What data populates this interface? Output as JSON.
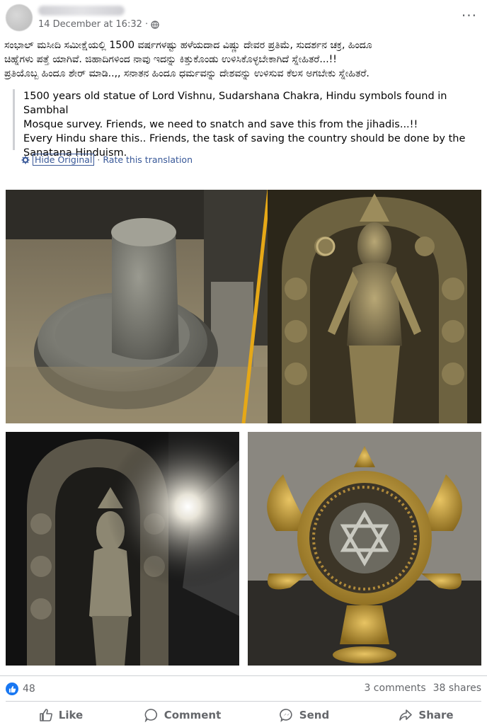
{
  "post": {
    "timestamp": "14 December at 16:32 ·",
    "privacy_icon": "globe-icon",
    "more_label": "···",
    "text_line1": "ಸಂಭಾಲ್ ಮಸೀದಿ ಸಮೀಕ್ಷೆಯಲ್ಲಿ 1500 ವರ್ಷಗಳಷ್ಟು ಹಳೆಯದಾದ ವಿಷ್ಣು ದೇವರ ಪ್ರತಿಮೆ, ಸುದರ್ಶನ ಚಕ್ರ, ಹಿಂದೂ",
    "text_line2": "ಚಿಹ್ನೆಗಳು ಪತ್ತೆ ಯಾಗಿವೆ. ಜಿಹಾದಿಗಳಿಂದ ನಾವು ಇದನ್ನು ಕಿತ್ತುಕೊಂಡು ಉಳಿಸಿಕೊಳ್ಳಬೇಕಾಗಿದೆ ಸ್ನೇಹಿತರೆ...!!",
    "text_line3": "ಪ್ರತಿಯೊಬ್ಬ ಹಿಂದೂ ಶೇರ್ ಮಾಡಿ..,,  ಸನಾತನ ಹಿಂದೂ ಧರ್ಮವನ್ನು ದೇಶವನ್ನು ಉಳಿಸುವ ಕೆಲಸ ಅಗಬೇಕು ಸ್ನೇಹಿತರೆ."
  },
  "translation": {
    "line1": "1500 years old statue of Lord Vishnu, Sudarshana Chakra, Hindu symbols found in Sambhal",
    "line2": "Mosque survey. Friends, we need to snatch and save this from the jihadis...!!",
    "line3": "Every Hindu share this.. Friends, the task of saving the country should be done by the",
    "line4": "Sanatana Hinduism.",
    "hide_label": "Hide Original",
    "separator": "·",
    "rate_label": "Rate this translation"
  },
  "footer": {
    "like_count": "48",
    "comments": "3 comments",
    "shares": "38 shares",
    "actions": [
      "Like",
      "Comment",
      "Send",
      "Share"
    ]
  },
  "colors": {
    "link": "#385898",
    "muted": "#65676b",
    "like_blue": "#1877f2",
    "gold_divider": "#e6a817"
  }
}
